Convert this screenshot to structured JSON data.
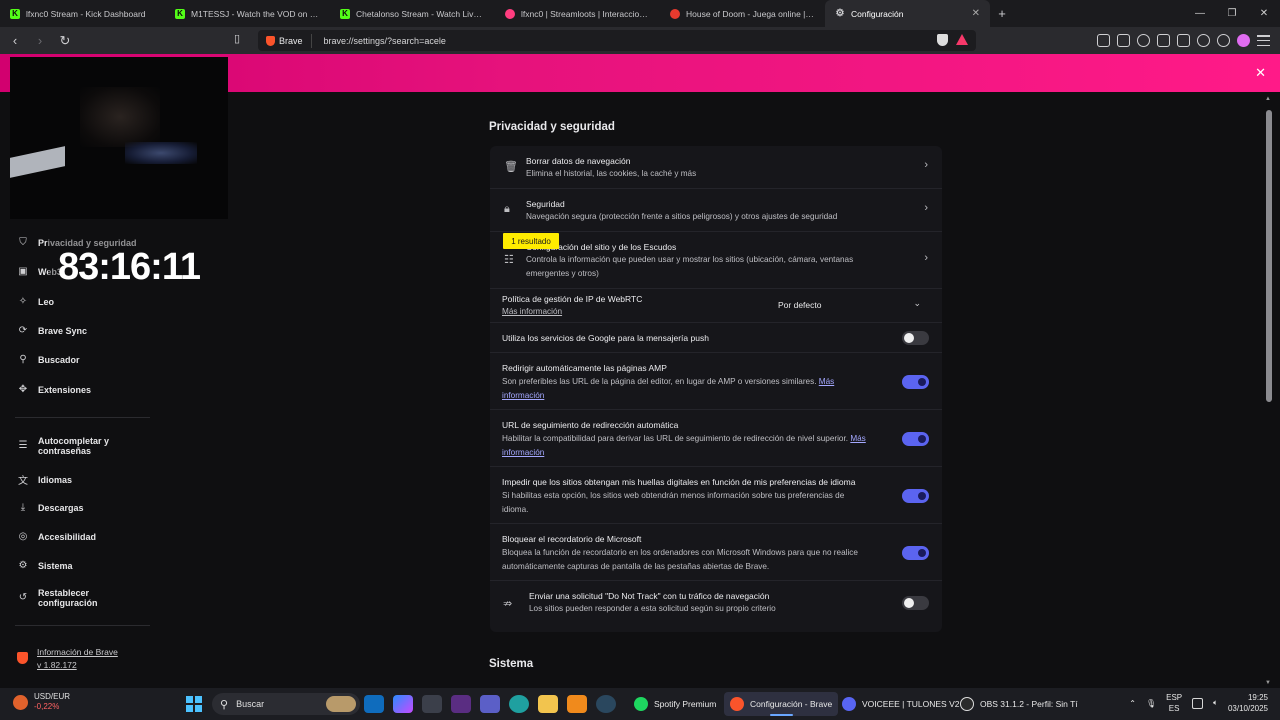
{
  "tabs": [
    {
      "title": "lfxnc0 Stream - Kick Dashboard",
      "color": "#53fc18",
      "glyph": "K"
    },
    {
      "title": "M1TESSJ - Watch the VOD on Kick",
      "color": "#53fc18",
      "glyph": "K"
    },
    {
      "title": "Chetalonso Stream - Watch Live on Kick",
      "color": "#53fc18",
      "glyph": "K"
    },
    {
      "title": "lfxnc0 | Streamloots | Interacciones con tu streamer",
      "color": "#ff3d7f",
      "glyph": ""
    },
    {
      "title": "House of Doom - Juega online | Beta",
      "color": "#e63a2e",
      "glyph": ""
    },
    {
      "title": "Configuración",
      "color": "#cfcfd2",
      "glyph": "⚙"
    }
  ],
  "toolbar": {
    "brave_label": "Brave",
    "url": "brave://settings/?search=acele"
  },
  "timer": "83:16:11",
  "nav": {
    "items": [
      {
        "label": "Privacidad y seguridad",
        "icon": "shield-icon",
        "glyph": "⛉"
      },
      {
        "label": "Web3",
        "icon": "wallet-icon",
        "glyph": "▣"
      },
      {
        "label": "Leo",
        "icon": "leo-icon",
        "glyph": "✧"
      },
      {
        "label": "Brave Sync",
        "icon": "sync-icon",
        "glyph": "⟳"
      },
      {
        "label": "Buscador",
        "icon": "search-icon",
        "glyph": "⚲"
      },
      {
        "label": "Extensiones",
        "icon": "puzzle-icon",
        "glyph": "✥"
      },
      {
        "label": "Autocompletar y contraseñas",
        "icon": "list-icon",
        "glyph": "☰"
      },
      {
        "label": "Idiomas",
        "icon": "translate-icon",
        "glyph": "文"
      },
      {
        "label": "Descargas",
        "icon": "download-icon",
        "glyph": "⤓"
      },
      {
        "label": "Accesibilidad",
        "icon": "accessibility-icon",
        "glyph": "◎"
      },
      {
        "label": "Sistema",
        "icon": "gear-icon",
        "glyph": "⚙"
      },
      {
        "label": "Restablecer configuración",
        "icon": "reset-icon",
        "glyph": "↺"
      }
    ],
    "brave_info": {
      "title": "Información de Brave",
      "version": "v 1.82.172"
    }
  },
  "section": {
    "title": "Privacidad y seguridad",
    "next_title": "Sistema",
    "search_badge": "1 resultado",
    "rows": [
      {
        "title": "Borrar datos de navegación",
        "subtitle": "Elimina el historial, las cookies, la caché y más"
      },
      {
        "title": "Seguridad",
        "subtitle": "Navegación segura (protección frente a sitios peligrosos) y otros ajustes de seguridad"
      },
      {
        "title": "Configuración del sitio y de los Escudos",
        "subtitle": "Controla la información que pueden usar y mostrar los sitios (ubicación, cámara, ventanas emergentes y otros)"
      },
      {
        "title": "Política de gestión de IP de WebRTC",
        "link": "Más información",
        "select": "Por defecto"
      },
      {
        "title": "Utiliza los servicios de Google para la mensajería push",
        "toggle": false
      },
      {
        "title": "Redirigir automáticamente las páginas AMP",
        "subtitle": "Son preferibles las URL de la página del editor, en lugar de AMP o versiones similares.",
        "link": "Más información",
        "toggle": true
      },
      {
        "title": "URL de seguimiento de redirección automática",
        "subtitle": "Habilitar la compatibilidad para derivar las URL de seguimiento de redirección de nivel superior.",
        "link": "Más información",
        "toggle": true
      },
      {
        "title": "Impedir que los sitios obtengan mis huellas digitales en función de mis preferencias de idioma",
        "subtitle": "Si habilitas esta opción, los sitios web obtendrán menos información sobre tus preferencias de idioma.",
        "toggle": true
      },
      {
        "title": "Bloquear el recordatorio de Microsoft",
        "subtitle": "Bloquea la función de recordatorio en los ordenadores con Microsoft Windows para que no realice automáticamente capturas de pantalla de las pestañas abiertas de Brave.",
        "toggle": true
      },
      {
        "title": "Enviar una solicitud \"Do Not Track\" con tu tráfico de navegación",
        "subtitle": "Los sitios pueden responder a esta solicitud según su propio criterio",
        "toggle": false
      }
    ]
  },
  "taskbar": {
    "ticker": {
      "symbol": "USD/EUR",
      "change": "-0,22%"
    },
    "search_placeholder": "Buscar",
    "tasks": [
      {
        "label": "Spotify Premium",
        "color": "#1ed760"
      },
      {
        "label": "Configuración - Brave",
        "color": "#fb542b"
      },
      {
        "label": "VOICEEE | TULONES V2",
        "color": "#5865f2"
      },
      {
        "label": "OBS 31.1.2 - Perfil: Sin Tí",
        "color": "#dddddd"
      }
    ],
    "lang": {
      "top": "ESP",
      "bottom": "ES"
    },
    "time": "19:25",
    "date": "03/10/2025"
  },
  "colors": {
    "banner": "#e6127c",
    "toggle_on": "#5b64f0",
    "accent_link": "#a4a8ff",
    "highlight": "#ffec00"
  }
}
